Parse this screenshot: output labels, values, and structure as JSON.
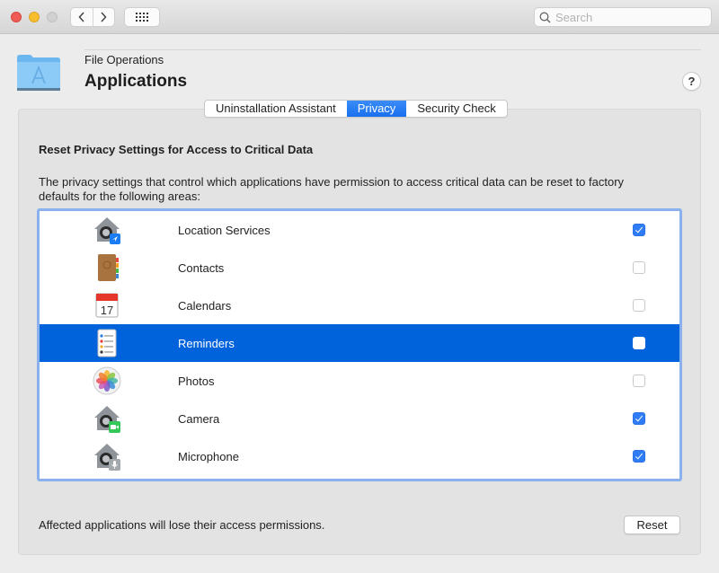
{
  "window": {
    "search_placeholder": "Search",
    "nav_back": "‹",
    "nav_forward": "›"
  },
  "header": {
    "subtitle": "File Operations",
    "title": "Applications",
    "help_label": "?"
  },
  "tabs": [
    {
      "label": "Uninstallation Assistant",
      "active": false
    },
    {
      "label": "Privacy",
      "active": true
    },
    {
      "label": "Security Check",
      "active": false
    }
  ],
  "privacy": {
    "heading": "Reset Privacy Settings for Access to Critical Data",
    "description": "The privacy settings that control which applications have permission to access critical data can be reset to factory defaults for the following areas:",
    "items": [
      {
        "label": "Location Services",
        "icon": "location-services-icon",
        "checked": true,
        "selected": false
      },
      {
        "label": "Contacts",
        "icon": "contacts-icon",
        "checked": false,
        "selected": false
      },
      {
        "label": "Calendars",
        "icon": "calendar-icon",
        "checked": false,
        "selected": false
      },
      {
        "label": "Reminders",
        "icon": "reminders-icon",
        "checked": false,
        "selected": true
      },
      {
        "label": "Photos",
        "icon": "photos-icon",
        "checked": false,
        "selected": false
      },
      {
        "label": "Camera",
        "icon": "camera-icon",
        "checked": true,
        "selected": false
      },
      {
        "label": "Microphone",
        "icon": "microphone-icon",
        "checked": true,
        "selected": false
      }
    ],
    "calendar_day": "17",
    "footer_note": "Affected applications will lose their access permissions.",
    "reset_label": "Reset"
  },
  "colors": {
    "accent": "#1870ef",
    "selection": "#0063dc",
    "checkbox_checked": "#2f7cf6"
  }
}
